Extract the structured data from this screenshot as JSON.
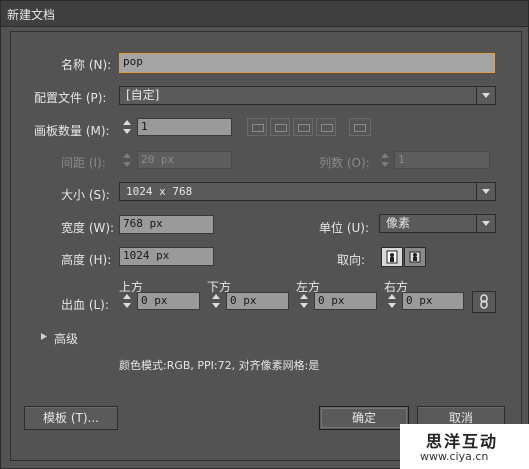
{
  "window": {
    "title": "新建文档"
  },
  "name": {
    "label": "名称 (N):",
    "value": "pop"
  },
  "profile": {
    "label": "配置文件 (P):",
    "value": "[自定]"
  },
  "artboards": {
    "label": "画板数量 (M):",
    "value": "1"
  },
  "spacing": {
    "label": "间距 (I):",
    "value": "20 px"
  },
  "columns": {
    "label": "列数 (O):",
    "value": "1"
  },
  "size": {
    "label": "大小 (S):",
    "value": "1024 x 768"
  },
  "width": {
    "label": "宽度 (W):",
    "value": "768 px"
  },
  "units": {
    "label": "单位 (U):",
    "value": "像素"
  },
  "height": {
    "label": "高度 (H):",
    "value": "1024 px"
  },
  "orientation": {
    "label": "取向:"
  },
  "bleed": {
    "label": "出血 (L):",
    "top": {
      "label": "上方",
      "value": "0 px"
    },
    "bottom": {
      "label": "下方",
      "value": "0 px"
    },
    "left": {
      "label": "左方",
      "value": "0 px"
    },
    "right": {
      "label": "右方",
      "value": "0 px"
    }
  },
  "advanced": {
    "label": "高级"
  },
  "summary": {
    "text": "颜色模式:RGB, PPI:72, 对齐像素网格:是"
  },
  "buttons": {
    "templates": "模板 (T)...",
    "ok": "确定",
    "cancel": "取消"
  },
  "watermark": {
    "line1": "思洋互动",
    "line2": "www.ciya.cn"
  }
}
